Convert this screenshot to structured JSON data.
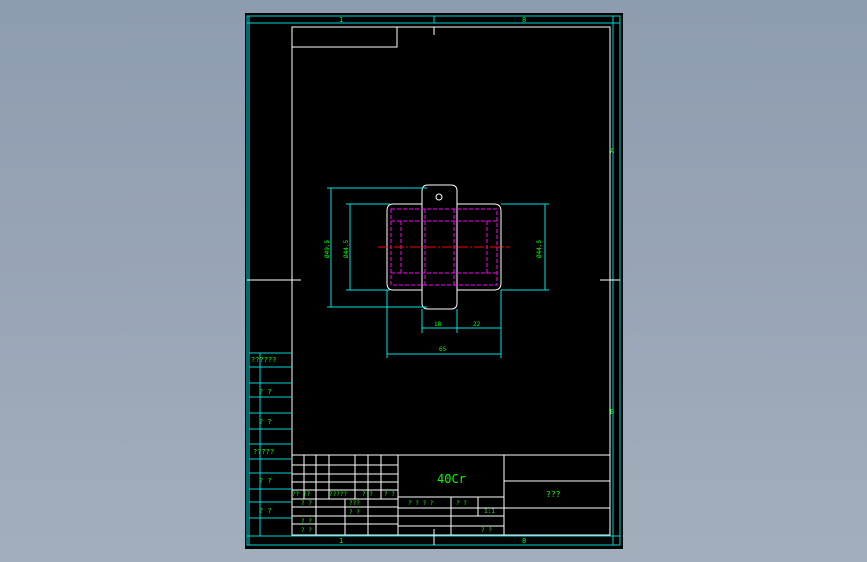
{
  "title_block": {
    "material": "40Cr",
    "drawing_name": "???",
    "scale_label": "? ? ? ?",
    "ratio_label": "? ?",
    "ratio_value": "1:1",
    "sheet_label": "? ?",
    "header_signature": "?? ??",
    "header_change_no": "?????",
    "header_sign": "? ?",
    "header_date": "? ?",
    "design_label": "? ?",
    "standard_label": "???",
    "review_label": "? ?",
    "process_label": "? ?",
    "approve_label": "? ?"
  },
  "side_table": {
    "rows": [
      "??????",
      "? ?",
      "? ?",
      "?????",
      "? ?",
      "? ?"
    ]
  },
  "zones": {
    "top_left": "1",
    "top_right": "8",
    "right_upper": "A",
    "right_lower": "B",
    "bottom_left": "1",
    "bottom_right": "8"
  },
  "dimensions": {
    "outer_dia": "Ø49.5",
    "inner_dia": "Ø44.5",
    "right_dia": "Ø44.5",
    "bottom_a": "18",
    "bottom_b": "22",
    "bottom_total": "65"
  },
  "colors": {
    "frame": "#00d4d4",
    "dimension": "#00e0e0",
    "text": "#00ff00",
    "outline": "#ffffff",
    "hidden": "#ff00ff",
    "centerline": "#ff0000"
  }
}
